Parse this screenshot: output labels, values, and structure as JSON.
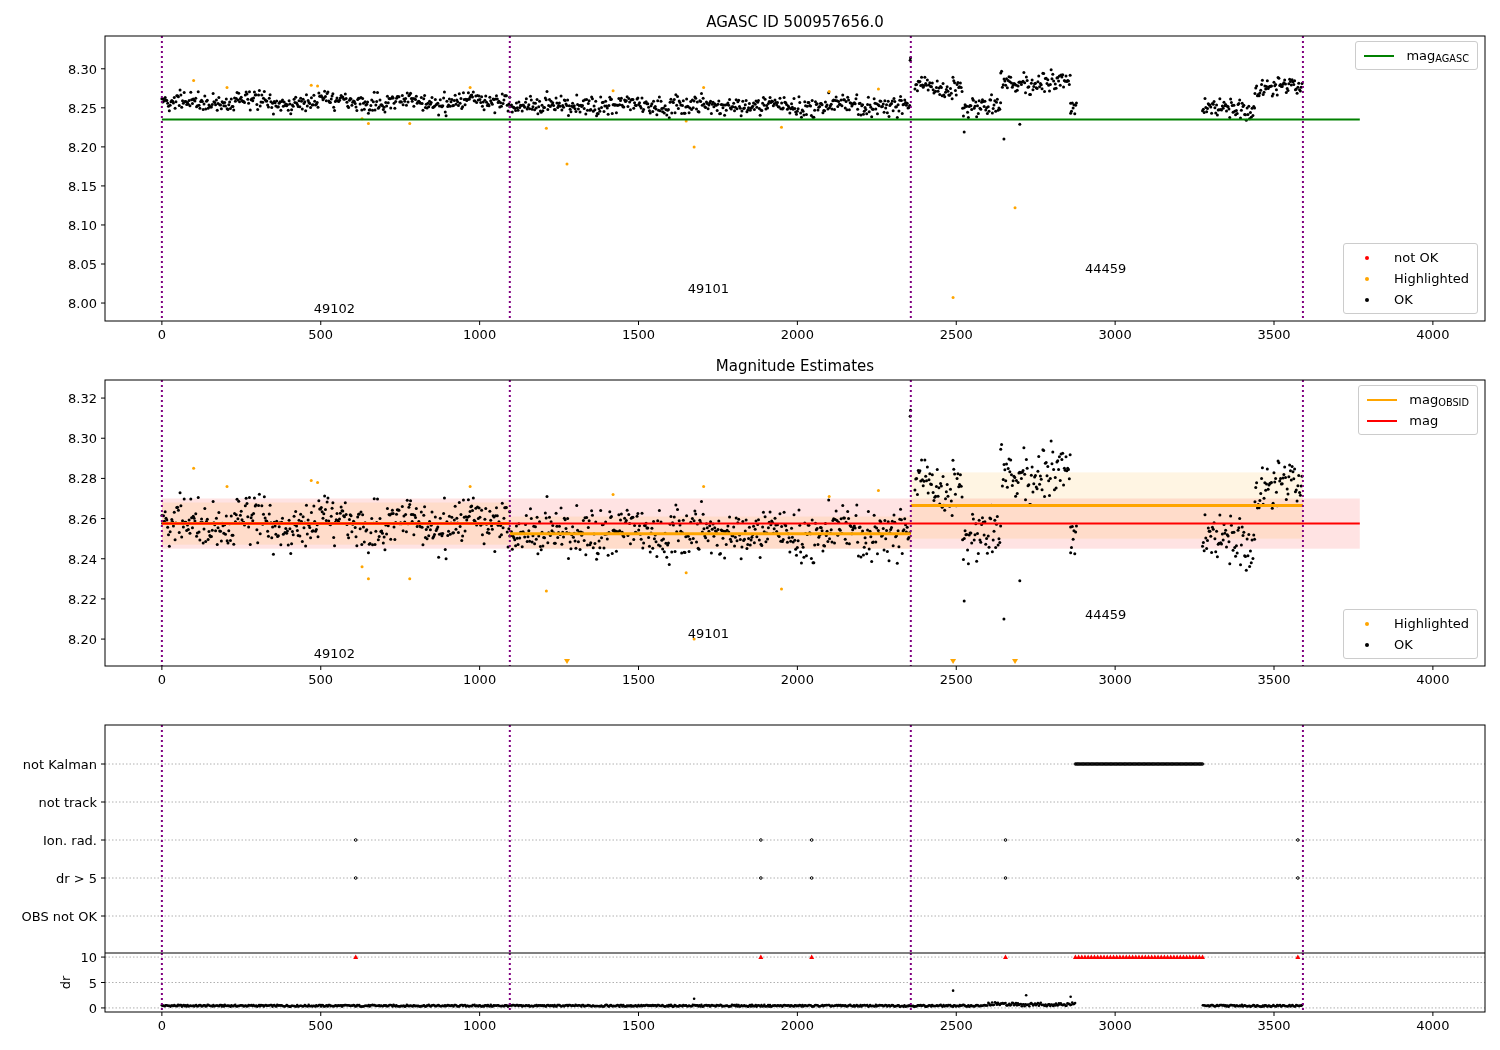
{
  "figure": {
    "panels": [
      {
        "kind": "magnitude",
        "title": "AGASC ID 500957656.0",
        "chart_data": {
          "type": "line",
          "xlim": [
            -179,
            4164
          ],
          "ylim": [
            7.977,
            8.342
          ],
          "xticks": [
            0,
            500,
            1000,
            1500,
            2000,
            2500,
            3000,
            3500,
            4000
          ],
          "yticks": [
            {
              "value": 8.0,
              "label": "8.00"
            },
            {
              "value": 8.05,
              "label": "8.05"
            },
            {
              "value": 8.1,
              "label": "8.10"
            },
            {
              "value": 8.15,
              "label": "8.15"
            },
            {
              "value": 8.2,
              "label": "8.20"
            },
            {
              "value": 8.25,
              "label": "8.25"
            },
            {
              "value": 8.3,
              "label": "8.30"
            }
          ],
          "series": [
            {
              "name": "mag$_{AGASC}$",
              "color": "#008000",
              "x": [
                0,
                3770
              ],
              "values": [
                8.235,
                8.235
              ]
            }
          ],
          "legend": "upper right",
          "ref_lines": [
            {
              "axis": "x",
              "value": 0,
              "color": "#800080"
            },
            {
              "axis": "x",
              "value": 1095,
              "color": "#800080"
            },
            {
              "axis": "x",
              "value": 2357,
              "color": "#800080"
            },
            {
              "axis": "x",
              "value": 3591,
              "color": "#800080"
            }
          ],
          "annotations": [
            "49102",
            "49101",
            "44459"
          ]
        },
        "marker_legend": [
          {
            "label": "not OK",
            "color": "#ff0000"
          },
          {
            "label": "Highlighted",
            "color": "#ffa500"
          },
          {
            "label": "OK",
            "color": "#000000"
          }
        ]
      },
      {
        "kind": "magnitude",
        "title": "Magnitude Estimates",
        "chart_data": {
          "type": "line",
          "xlim": [
            -179,
            4164
          ],
          "ylim": [
            8.1866,
            8.329
          ],
          "xticks": [
            0,
            500,
            1000,
            1500,
            2000,
            2500,
            3000,
            3500,
            4000
          ],
          "yticks": [
            {
              "value": 8.2,
              "label": "8.20"
            },
            {
              "value": 8.22,
              "label": "8.22"
            },
            {
              "value": 8.24,
              "label": "8.24"
            },
            {
              "value": 8.26,
              "label": "8.26"
            },
            {
              "value": 8.28,
              "label": "8.28"
            },
            {
              "value": 8.3,
              "label": "8.30"
            },
            {
              "value": 8.32,
              "label": "8.32"
            }
          ],
          "series": [
            {
              "name": "mag$_{OBSID}$",
              "color": "#ffa500",
              "x": [
                0,
                1095,
                null,
                1095,
                2357,
                null,
                2357,
                3591
              ],
              "values": [
                8.2575,
                8.2575,
                null,
                8.2525,
                8.2525,
                null,
                8.2665,
                8.2665
              ]
            },
            {
              "name": "mag",
              "color": "#ff0000",
              "x": [
                0,
                3770
              ],
              "values": [
                8.2575,
                8.2575
              ]
            }
          ],
          "legend": "upper right",
          "bands": [
            {
              "axis": "y",
              "from": 8.245,
              "to": 8.27,
              "color": "#ff0000"
            },
            {
              "axis": "y",
              "from": 8.247,
              "to": 8.268,
              "color": "#ffa500"
            },
            {
              "axis": "y",
              "from": 8.245,
              "to": 8.261,
              "color": "#ffa500"
            },
            {
              "axis": "y",
              "from": 8.25,
              "to": 8.283,
              "color": "#ffa500"
            }
          ],
          "ref_lines": [
            {
              "axis": "x",
              "value": 0,
              "color": "#800080"
            },
            {
              "axis": "x",
              "value": 1095,
              "color": "#800080"
            },
            {
              "axis": "x",
              "value": 2357,
              "color": "#800080"
            },
            {
              "axis": "x",
              "value": 3591,
              "color": "#800080"
            }
          ],
          "annotations": [
            "49102",
            "49101",
            "44459"
          ]
        },
        "marker_legend": [
          {
            "label": "Highlighted",
            "color": "#ffa500"
          },
          {
            "label": "OK",
            "color": "#000000"
          }
        ]
      },
      {
        "kind": "flags",
        "rows": [
          "not Kalman",
          "not track",
          "Ion. rad.",
          "dr > 5",
          "OBS not OK"
        ]
      },
      {
        "kind": "dr",
        "chart_data": {
          "type": "scatter",
          "xlim": [
            -179,
            4164
          ],
          "ylim": [
            -0.8,
            10.8
          ],
          "ylabel": "dr",
          "grid": true,
          "xticks": [
            0,
            500,
            1000,
            1500,
            2000,
            2500,
            3000,
            3500,
            4000
          ],
          "yticks": [
            0,
            5,
            10
          ],
          "series": [
            {
              "color": "#ff0000",
              "x": [
                610,
                1885,
                2045,
                2655,
                3575,
                2875,
                2885,
                2895,
                2905,
                2915,
                2925,
                2935,
                2945,
                2955,
                2965,
                2975,
                2985,
                2995,
                3005,
                3015,
                3025,
                3035,
                3045,
                3055,
                3065,
                3075,
                3085,
                3095,
                3105,
                3115,
                3125,
                3135,
                3145,
                3155,
                3165,
                3175,
                3185,
                3195,
                3205,
                3215,
                3225,
                3235,
                3245,
                3255,
                3265,
                3275
              ],
              "values": [
                10,
                10,
                10,
                10,
                10,
                10,
                10,
                10,
                10,
                10,
                10,
                10,
                10,
                10,
                10,
                10,
                10,
                10,
                10,
                10,
                10,
                10,
                10,
                10,
                10,
                10,
                10,
                10,
                10,
                10,
                10,
                10,
                10,
                10,
                10,
                10,
                10,
                10,
                10,
                10,
                10,
                10,
                10,
                10,
                10,
                10
              ]
            }
          ],
          "ref_lines": [
            {
              "axis": "x",
              "value": 0,
              "color": "#800080"
            },
            {
              "axis": "x",
              "value": 1095,
              "color": "#800080"
            },
            {
              "axis": "x",
              "value": 2357,
              "color": "#800080"
            },
            {
              "axis": "x",
              "value": 3591,
              "color": "#800080"
            }
          ]
        }
      }
    ]
  }
}
